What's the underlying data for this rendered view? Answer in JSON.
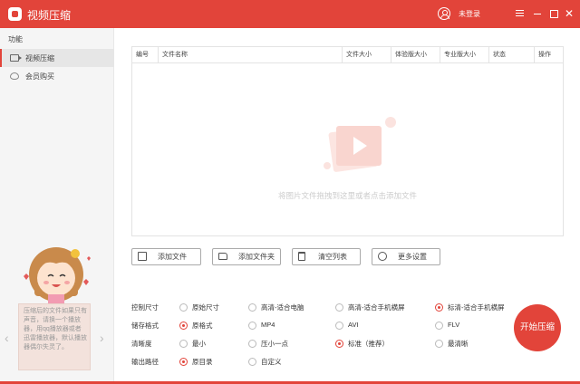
{
  "window": {
    "title": "视频压缩",
    "login": "未登录",
    "close_glyph": "✕"
  },
  "sidebar": {
    "header": "功能",
    "items": [
      {
        "label": "视频压缩",
        "icon": "video-icon",
        "active": true
      },
      {
        "label": "会员购买",
        "icon": "vip-icon",
        "active": false
      }
    ]
  },
  "promo": {
    "text": "压缩后的文件如果只有声音，请换一个播放器，用qq播放器或者迅雷播放器，默认播放器偶尔失灵了。",
    "prev": "‹",
    "next": "›"
  },
  "file_table": {
    "columns": [
      "编号",
      "文件名称",
      "文件大小",
      "体验版大小",
      "专业版大小",
      "状态",
      "操作"
    ],
    "empty_hint": "将图片文件拖拽到这里或者点击添加文件"
  },
  "toolbar": {
    "add_file": "添加文件",
    "add_folder": "添加文件夹",
    "clear_list": "清空列表",
    "more_settings": "更多设置"
  },
  "options": {
    "size": {
      "label": "控制尺寸",
      "choices": [
        "原始尺寸",
        "高清-适合电脑",
        "高清-适合手机横屏",
        "标清-适合手机横屏"
      ],
      "selected": 3
    },
    "format": {
      "label": "储存格式",
      "choices": [
        "原格式",
        "MP4",
        "AVI",
        "FLV"
      ],
      "selected": 0
    },
    "clarity": {
      "label": "清晰度",
      "choices": [
        "最小",
        "压小一点",
        "标准（推荐）",
        "最清晰"
      ],
      "selected": 2
    },
    "output": {
      "label": "输出路径",
      "choices": [
        "原目录",
        "自定义"
      ],
      "selected": 0
    }
  },
  "start_button": "开始压缩",
  "colors": {
    "accent": "#e2443a"
  }
}
